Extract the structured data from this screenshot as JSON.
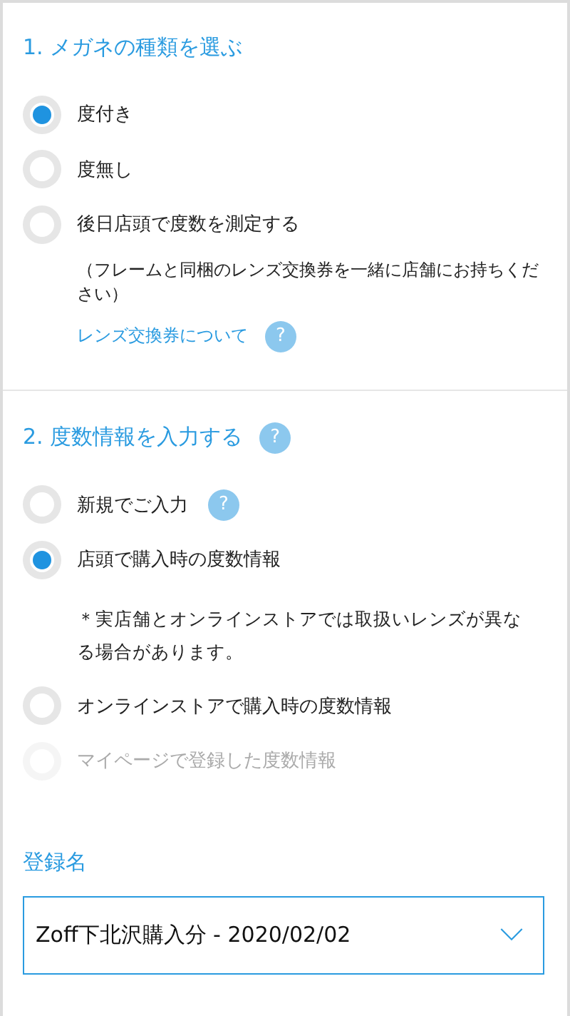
{
  "sections": [
    {
      "title": "1. メガネの種類を選ぶ",
      "options": [
        {
          "label": "度付き",
          "selected": true,
          "disabled": false
        },
        {
          "label": "度無し",
          "selected": false,
          "disabled": false
        },
        {
          "label": "後日店頭で度数を測定する",
          "selected": false,
          "disabled": false,
          "note": "（フレームと同梱のレンズ交換券を一緒に店舗にお持ちください）",
          "link": {
            "label": "レンズ交換券について",
            "help": "?"
          }
        }
      ]
    },
    {
      "title": "2. 度数情報を入力する",
      "help": "?",
      "options": [
        {
          "label": "新規でご入力",
          "selected": false,
          "disabled": false,
          "help": "?"
        },
        {
          "label": "店頭で購入時の度数情報",
          "selected": true,
          "disabled": false,
          "note": "＊実店舗とオンラインストアでは取扱いレンズが異なる場合があります。"
        },
        {
          "label": "オンラインストアで購入時の度数情報",
          "selected": false,
          "disabled": false
        },
        {
          "label": "マイページで登録した度数情報",
          "selected": false,
          "disabled": true
        }
      ],
      "field": {
        "label": "登録名",
        "value": "Zoff下北沢購入分 - 2020/02/02"
      }
    }
  ]
}
